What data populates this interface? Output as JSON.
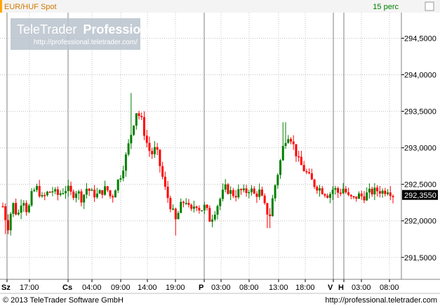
{
  "header": {
    "instrument": "EUR/HUF Spot",
    "interval": "15 perc"
  },
  "watermark": {
    "brand": "TeleTrader",
    "product": "Professional",
    "url": "http://professional.teletrader.com/"
  },
  "footer": {
    "copyright": "© 2013 TeleTrader Software GmbH",
    "url": "http://professional.teletrader.com"
  },
  "colors": {
    "up": "#008000",
    "down": "#ff0000",
    "grid": "#c0c0c0",
    "last_price_bg": "#000000"
  },
  "chart_data": {
    "type": "candlestick",
    "ylim": [
      291.2,
      294.85
    ],
    "y_ticks": [
      {
        "value": 291.5,
        "label": "291,5000"
      },
      {
        "value": 292.0,
        "label": "292,0000"
      },
      {
        "value": 292.5,
        "label": "292,5000"
      },
      {
        "value": 293.0,
        "label": "293,0000"
      },
      {
        "value": 293.5,
        "label": "293,5000"
      },
      {
        "value": 294.0,
        "label": "294,0000"
      },
      {
        "value": 294.5,
        "label": "294,5000"
      }
    ],
    "last_price": {
      "value": 292.355,
      "label": "292,3550"
    },
    "x_ticks": [
      {
        "label": "Sz",
        "bold": true
      },
      {
        "label": "17:00",
        "bold": false
      },
      {
        "label": "Cs",
        "bold": true
      },
      {
        "label": "04:00",
        "bold": false
      },
      {
        "label": "09:00",
        "bold": false
      },
      {
        "label": "14:00",
        "bold": false
      },
      {
        "label": "19:00",
        "bold": false
      },
      {
        "label": "P",
        "bold": true
      },
      {
        "label": "03:00",
        "bold": false
      },
      {
        "label": "08:00",
        "bold": false
      },
      {
        "label": "13:00",
        "bold": false
      },
      {
        "label": "18:00",
        "bold": false
      },
      {
        "label": "V",
        "bold": true
      },
      {
        "label": "H",
        "bold": true
      },
      {
        "label": "03:00",
        "bold": false
      },
      {
        "label": "08:00",
        "bold": false
      }
    ],
    "price_path": [
      292.2,
      291.9,
      292.25,
      292.05,
      292.35,
      292.1,
      292.4,
      292.45,
      292.3,
      292.38,
      292.42,
      292.35,
      292.4,
      292.45,
      292.35,
      292.42,
      292.3,
      292.45,
      292.38,
      292.35,
      292.4,
      292.45,
      292.3,
      292.5,
      292.65,
      292.9,
      293.2,
      293.5,
      293.4,
      293.1,
      292.9,
      293.0,
      292.7,
      292.4,
      292.2,
      292.0,
      292.2,
      292.3,
      292.1,
      292.25,
      292.15,
      292.2,
      292.0,
      292.15,
      292.3,
      292.45,
      292.4,
      292.35,
      292.42,
      292.38,
      292.45,
      292.35,
      292.4,
      292.2,
      292.05,
      292.45,
      292.75,
      293.1,
      293.2,
      293.0,
      292.8,
      292.7,
      292.6,
      292.5,
      292.45,
      292.4,
      292.35,
      292.45,
      292.38,
      292.45,
      292.32,
      292.3,
      292.35,
      292.33,
      292.38,
      292.4,
      292.42,
      292.4,
      292.44,
      292.355
    ],
    "highs": [
      {
        "index": 26,
        "value": 293.75
      },
      {
        "index": 57,
        "value": 293.35
      }
    ],
    "lows": [
      {
        "index": 1,
        "value": 291.82
      },
      {
        "index": 35,
        "value": 291.8
      },
      {
        "index": 54,
        "value": 291.9
      }
    ]
  }
}
